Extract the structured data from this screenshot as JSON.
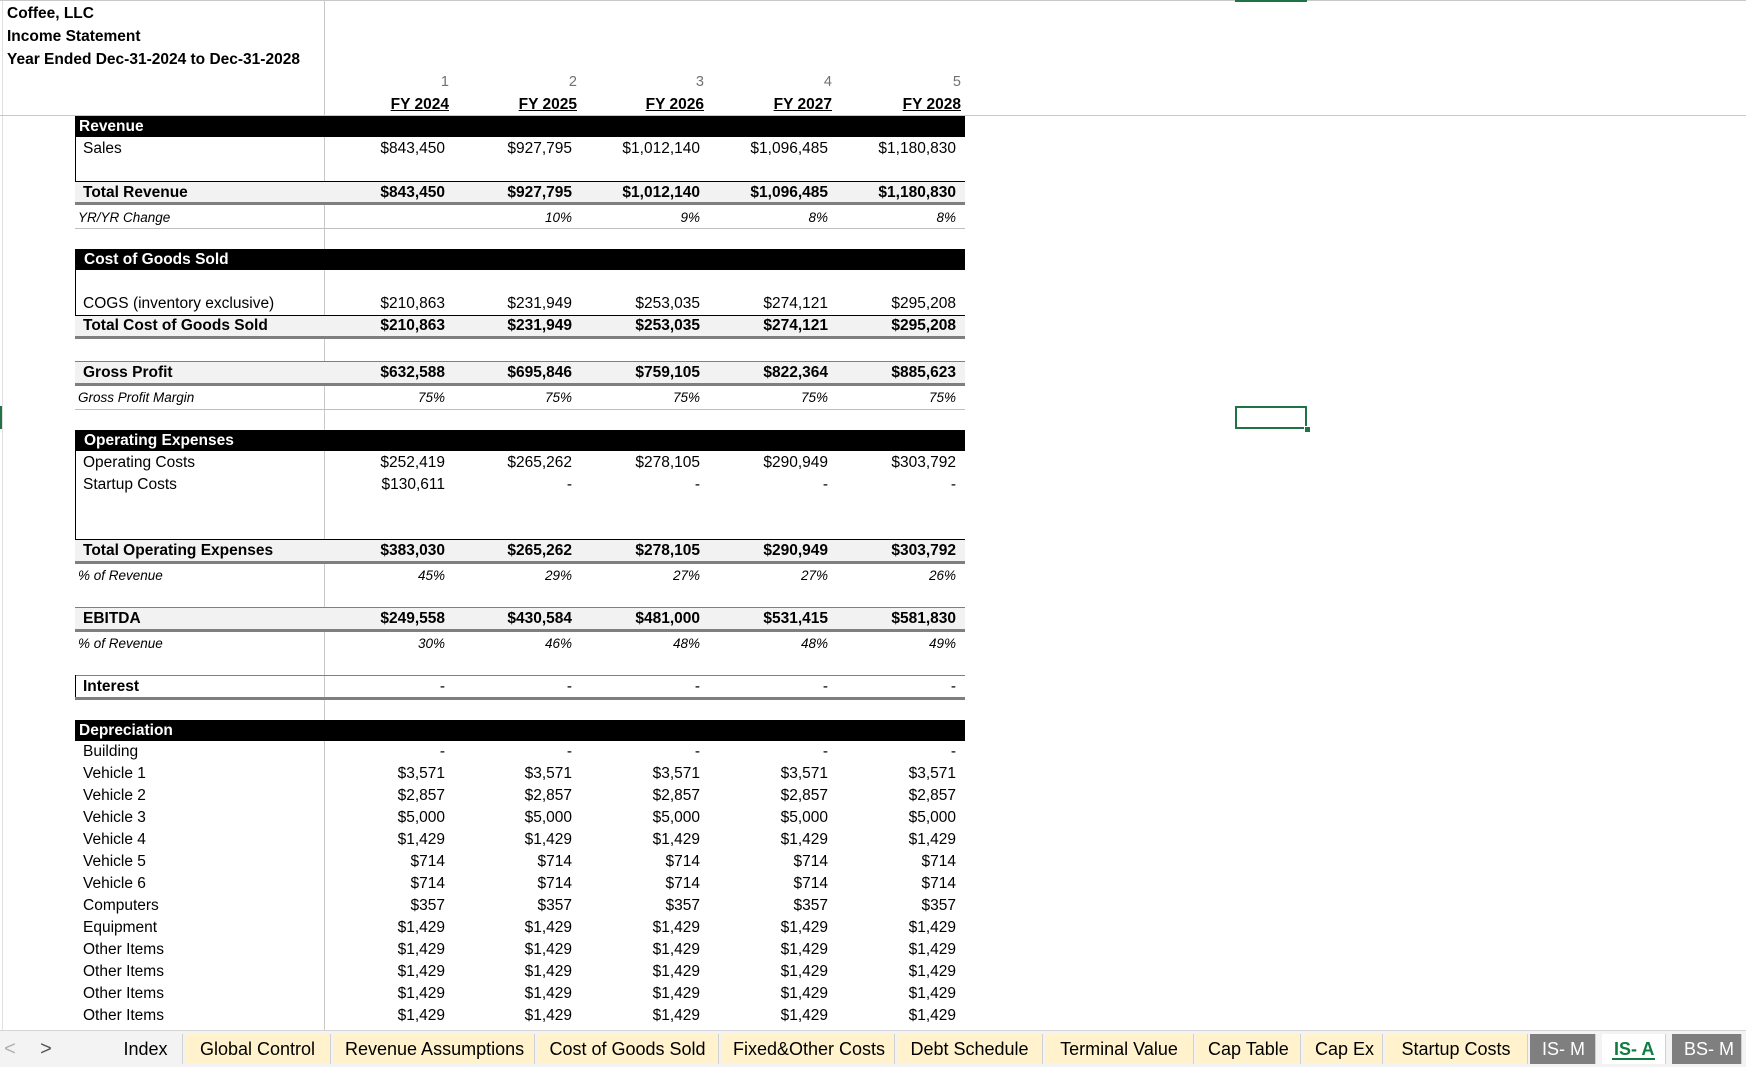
{
  "header": {
    "company": "Coffee, LLC",
    "statement": "Income Statement",
    "period": "Year Ended Dec-31-2024 to Dec-31-2028"
  },
  "columns": {
    "numbers": [
      "1",
      "2",
      "3",
      "4",
      "5"
    ],
    "years": [
      "FY 2024",
      "FY 2025",
      "FY 2026",
      "FY 2027",
      "FY 2028"
    ]
  },
  "revenue": {
    "section_title": "Revenue",
    "sales_label": "Sales",
    "sales": [
      "$843,450",
      "$927,795",
      "$1,012,140",
      "$1,096,485",
      "$1,180,830"
    ],
    "total_label": "Total Revenue",
    "total": [
      "$843,450",
      "$927,795",
      "$1,012,140",
      "$1,096,485",
      "$1,180,830"
    ],
    "yoy_label": "YR/YR Change",
    "yoy": [
      "",
      "10%",
      "9%",
      "8%",
      "8%"
    ]
  },
  "cogs": {
    "section_title": "Cost of Goods Sold",
    "line_label": "COGS (inventory exclusive)",
    "line": [
      "$210,863",
      "$231,949",
      "$253,035",
      "$274,121",
      "$295,208"
    ],
    "total_label": "Total Cost of Goods Sold",
    "total": [
      "$210,863",
      "$231,949",
      "$253,035",
      "$274,121",
      "$295,208"
    ]
  },
  "gross_profit": {
    "label": "Gross Profit",
    "values": [
      "$632,588",
      "$695,846",
      "$759,105",
      "$822,364",
      "$885,623"
    ],
    "margin_label": "Gross Profit Margin",
    "margin": [
      "75%",
      "75%",
      "75%",
      "75%",
      "75%"
    ]
  },
  "opex": {
    "section_title": "Operating Expenses",
    "operating_label": "Operating Costs",
    "operating": [
      "$252,419",
      "$265,262",
      "$278,105",
      "$290,949",
      "$303,792"
    ],
    "startup_label": "Startup Costs",
    "startup": [
      "$130,611",
      "-",
      "-",
      "-",
      "-"
    ],
    "total_label": "Total Operating Expenses",
    "total": [
      "$383,030",
      "$265,262",
      "$278,105",
      "$290,949",
      "$303,792"
    ],
    "pct_label": "% of Revenue",
    "pct": [
      "45%",
      "29%",
      "27%",
      "27%",
      "26%"
    ]
  },
  "ebitda": {
    "label": "EBITDA",
    "values": [
      "$249,558",
      "$430,584",
      "$481,000",
      "$531,415",
      "$581,830"
    ],
    "pct_label": "% of Revenue",
    "pct": [
      "30%",
      "46%",
      "48%",
      "48%",
      "49%"
    ]
  },
  "interest": {
    "label": "Interest",
    "values": [
      "-",
      "-",
      "-",
      "-",
      "-"
    ]
  },
  "depreciation": {
    "section_title": "Depreciation",
    "rows": [
      {
        "label": "Building",
        "values": [
          "-",
          "-",
          "-",
          "-",
          "-"
        ]
      },
      {
        "label": "Vehicle 1",
        "values": [
          "$3,571",
          "$3,571",
          "$3,571",
          "$3,571",
          "$3,571"
        ]
      },
      {
        "label": "Vehicle 2",
        "values": [
          "$2,857",
          "$2,857",
          "$2,857",
          "$2,857",
          "$2,857"
        ]
      },
      {
        "label": "Vehicle 3",
        "values": [
          "$5,000",
          "$5,000",
          "$5,000",
          "$5,000",
          "$5,000"
        ]
      },
      {
        "label": "Vehicle 4",
        "values": [
          "$1,429",
          "$1,429",
          "$1,429",
          "$1,429",
          "$1,429"
        ]
      },
      {
        "label": "Vehicle 5",
        "values": [
          "$714",
          "$714",
          "$714",
          "$714",
          "$714"
        ]
      },
      {
        "label": "Vehicle 6",
        "values": [
          "$714",
          "$714",
          "$714",
          "$714",
          "$714"
        ]
      },
      {
        "label": "Computers",
        "values": [
          "$357",
          "$357",
          "$357",
          "$357",
          "$357"
        ]
      },
      {
        "label": "Equipment",
        "values": [
          "$1,429",
          "$1,429",
          "$1,429",
          "$1,429",
          "$1,429"
        ]
      },
      {
        "label": "Other Items",
        "values": [
          "$1,429",
          "$1,429",
          "$1,429",
          "$1,429",
          "$1,429"
        ]
      },
      {
        "label": "Other Items",
        "values": [
          "$1,429",
          "$1,429",
          "$1,429",
          "$1,429",
          "$1,429"
        ]
      },
      {
        "label": "Other Items",
        "values": [
          "$1,429",
          "$1,429",
          "$1,429",
          "$1,429",
          "$1,429"
        ]
      },
      {
        "label": "Other Items",
        "values": [
          "$1,429",
          "$1,429",
          "$1,429",
          "$1,429",
          "$1,429"
        ]
      }
    ]
  },
  "nav": {
    "prev": "<",
    "next": ">"
  },
  "tabs": [
    {
      "label": "Index",
      "style": "plain"
    },
    {
      "label": "Global Control",
      "style": "yellow"
    },
    {
      "label": "Revenue Assumptions",
      "style": "yellow"
    },
    {
      "label": "Cost of Goods Sold",
      "style": "yellow"
    },
    {
      "label": "Fixed&Other Costs",
      "style": "yellow"
    },
    {
      "label": "Debt Schedule",
      "style": "yellow"
    },
    {
      "label": "Terminal Value",
      "style": "yellow"
    },
    {
      "label": "Cap Table",
      "style": "yellow"
    },
    {
      "label": "Cap Ex",
      "style": "yellow"
    },
    {
      "label": "Startup Costs",
      "style": "yellow"
    },
    {
      "label": "IS- M",
      "style": "dark"
    },
    {
      "label": "IS- A",
      "style": "active"
    },
    {
      "label": "BS- M",
      "style": "dark"
    }
  ],
  "colors": {
    "selection": "#217346",
    "tab_yellow": "#fff2cc",
    "tab_dark": "#7f7f7f",
    "active_tab_text": "#107c41"
  }
}
